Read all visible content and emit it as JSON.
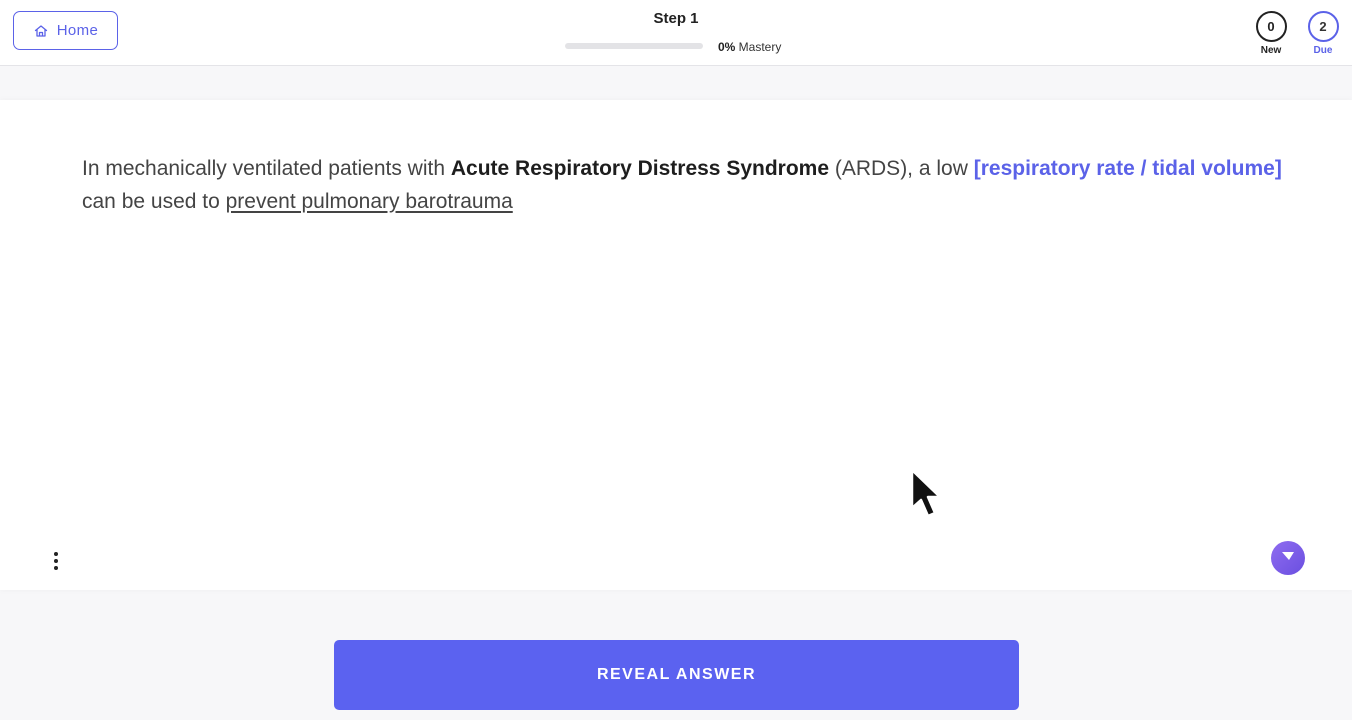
{
  "header": {
    "home_label": "Home",
    "step_title": "Step 1",
    "mastery_percent": "0%",
    "mastery_label": " Mastery",
    "mastery_progress": 0,
    "counters": {
      "new": {
        "value": "0",
        "label": "New"
      },
      "due": {
        "value": "2",
        "label": "Due"
      }
    }
  },
  "card": {
    "prompt_parts": {
      "p1": "In mechanically ventilated patients with ",
      "p2": "Acute Respiratory Distress Syndrome",
      "p3": " (ARDS), a low ",
      "p4": "[respiratory rate / tidal volume]",
      "p5": " can be used to ",
      "p6": "prevent pulmonary barotrauma"
    }
  },
  "actions": {
    "reveal_label": "REVEAL ANSWER"
  },
  "colors": {
    "accent": "#5b62e8",
    "button": "#5b62f0",
    "feedback": "#7b5ce8"
  }
}
